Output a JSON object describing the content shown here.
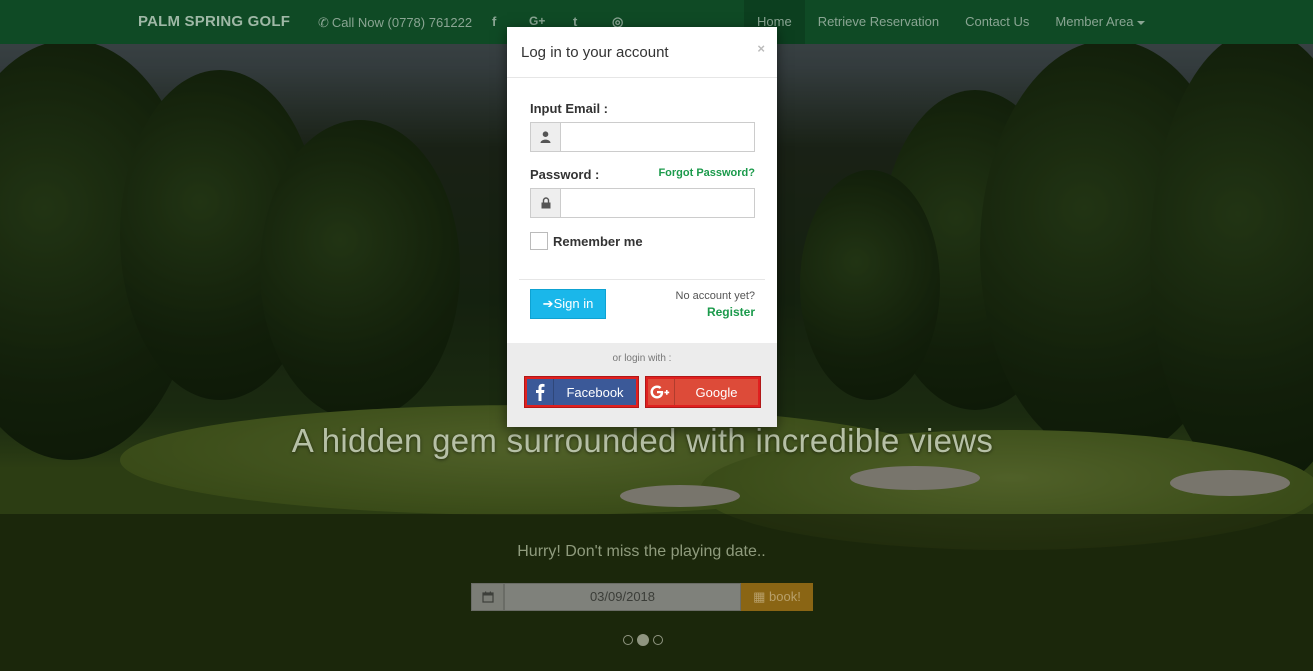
{
  "navbar": {
    "brand": "PALM SPRING GOLF",
    "call_text": "Call Now (0778) 761222",
    "social_icons": [
      "facebook-icon",
      "google-plus-icon",
      "twitter-icon",
      "instagram-icon"
    ],
    "social_glyphs": {
      "facebook": "f",
      "google_plus": "G+",
      "twitter": "t",
      "instagram": "◎"
    },
    "links": [
      {
        "label": "Home",
        "active": true
      },
      {
        "label": "Retrieve Reservation",
        "active": false
      },
      {
        "label": "Contact Us",
        "active": false
      },
      {
        "label": "Member Area",
        "active": false
      }
    ]
  },
  "hero": {
    "title": "A hidden gem surrounded with incredible views",
    "hurry_text": "Hurry! Don't miss the playing date..",
    "date_value": "03/09/2018",
    "book_label": "book!",
    "carousel_active_index": 1,
    "carousel_count": 3
  },
  "modal": {
    "title": "Log in to your account",
    "close_glyph": "×",
    "email_label": "Input Email :",
    "email_value": "",
    "password_label": "Password :",
    "password_value": "",
    "forgot_label": "Forgot Password?",
    "remember_label": "Remember me",
    "remember_checked": false,
    "signin_label": "Sign in",
    "no_account_text": "No account yet?",
    "register_label": "Register",
    "or_login_text": "or login with :",
    "facebook_label": "Facebook",
    "google_label": "Google"
  },
  "colors": {
    "navbar_bg": "#0f4a25",
    "accent_green": "#1b9a4b",
    "signin_blue": "#1ab7ea",
    "facebook_blue": "#3b5998",
    "google_red": "#dd4b39",
    "highlight_red": "#e0201f",
    "book_orange": "#8a6514"
  }
}
